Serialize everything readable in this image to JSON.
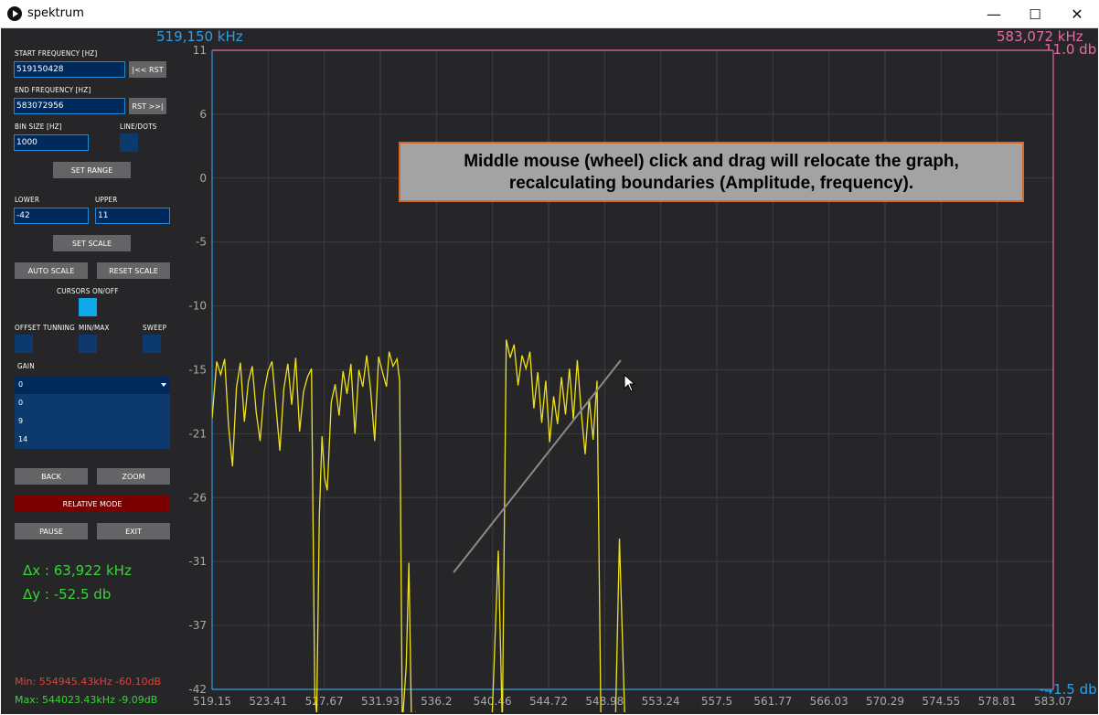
{
  "window": {
    "title": "spektrum",
    "min": "—",
    "max": "☐",
    "close": "✕"
  },
  "sidebar": {
    "start_label": "START FREQUENCY [HZ]",
    "start_value": "519150428",
    "rst_left": "|<< RST",
    "end_label": "END FREQUENCY [HZ]",
    "end_value": "583072956",
    "rst_right": "RST >>|",
    "bin_label": "BIN SIZE [HZ]",
    "bin_value": "1000",
    "line_dots_label": "LINE/DOTS",
    "set_range": "SET RANGE",
    "lower_label": "LOWER",
    "lower_value": "-42",
    "upper_label": "UPPER",
    "upper_value": "11",
    "set_scale": "SET SCALE",
    "auto_scale": "AUTO SCALE",
    "reset_scale": "RESET SCALE",
    "cursors_label": "CURSORS ON/OFF",
    "offset_label": "OFFSET TUNNING",
    "minmax_label": "MIN/MAX",
    "sweep_label": "SWEEP",
    "gain_label": "GAIN",
    "gain_selected": "0",
    "gain_options": [
      "0",
      "9",
      "14"
    ],
    "back": "BACK",
    "zoom": "ZOOM",
    "relative_mode": "RELATIVE MODE",
    "pause": "PAUSE",
    "exit": "EXIT",
    "dx": "Δx : 63,922 kHz",
    "dy": "Δy : -52.5 db",
    "min_stat": "Min: 554945.43kHz -60.10dB",
    "max_stat": "Max: 544023.43kHz -9.09dB"
  },
  "graph": {
    "freq_left": "519,150 kHz",
    "freq_right": "583,072 kHz",
    "amp_top": "11.0 db",
    "amp_bottom": "-41.5 db",
    "tooltip_line1": "Middle mouse (wheel) click and drag will relocate the graph,",
    "tooltip_line2": "recalculating boundaries (Amplitude, frequency).",
    "colors": {
      "trace": "#f0e21a",
      "grid": "#3d3d40",
      "freq_label": "#2e9ee6",
      "upper_label": "#e86aa8",
      "min_color": "#e0403a",
      "max_color": "#3ad43a"
    }
  },
  "chart_data": {
    "type": "line",
    "xlabel": "",
    "ylabel": "",
    "xlim": [
      519.15,
      583.07
    ],
    "ylim": [
      -42,
      11
    ],
    "x_ticks": [
      "519.15",
      "523.41",
      "527.67",
      "531.93",
      "536.2",
      "540.46",
      "544.72",
      "548.98",
      "553.24",
      "557.5",
      "561.77",
      "566.03",
      "570.29",
      "574.55",
      "578.81",
      "583.07"
    ],
    "y_ticks": [
      "11",
      "6",
      "0",
      "-5",
      "-10",
      "-15",
      "-21",
      "-26",
      "-31",
      "-37",
      "-42"
    ],
    "grid": true,
    "series": [
      {
        "color": "#f0e21a",
        "x": [
          519.15,
          519.5,
          519.8,
          520.1,
          520.4,
          520.7,
          521.0,
          521.3,
          521.6,
          521.9,
          522.2,
          522.5,
          522.8,
          523.1,
          523.4,
          523.7,
          524.0,
          524.3,
          524.6,
          524.9,
          525.2,
          525.5,
          525.8,
          526.1,
          526.4,
          526.7,
          526.95,
          527.1,
          527.3,
          527.5,
          527.7,
          527.9,
          528.2,
          528.5,
          528.8,
          529.1,
          529.4,
          529.7,
          530.0,
          530.3,
          530.6,
          530.9,
          531.2,
          531.5,
          531.8,
          532.1,
          532.4,
          532.6,
          532.9,
          533.2,
          533.4,
          533.6,
          533.9,
          534.1,
          534.3,
          534.6,
          534.8,
          535.0,
          535.3,
          535.5,
          535.8,
          536.2,
          536.8,
          537.4,
          538.0,
          538.6,
          539.2,
          539.8,
          540.4,
          540.9,
          541.2,
          541.5,
          541.8,
          542.1,
          542.4,
          542.7,
          543.0,
          543.3,
          543.6,
          543.9,
          544.2,
          544.5,
          544.8,
          545.1,
          545.4,
          545.7,
          546.0,
          546.3,
          546.6,
          546.9,
          547.2,
          547.5,
          547.8,
          548.1,
          548.4,
          548.7,
          548.9,
          549.1,
          549.3,
          549.5,
          549.8,
          550.1,
          550.5,
          551.0,
          551.5,
          552.0
        ],
        "y": [
          -19.5,
          -14.8,
          -15.9,
          -14.6,
          -20.2,
          -23.5,
          -17.0,
          -14.9,
          -19.8,
          -16.5,
          -15.2,
          -19.0,
          -21.4,
          -17.3,
          -15.6,
          -14.8,
          -18.5,
          -22.2,
          -17.1,
          -15.0,
          -18.4,
          -14.5,
          -20.6,
          -17.3,
          -16.1,
          -15.4,
          -42.5,
          -44.0,
          -27.5,
          -21.0,
          -24.5,
          -25.5,
          -18.2,
          -16.7,
          -19.3,
          -15.6,
          -17.5,
          -15.0,
          -20.8,
          -15.5,
          -16.9,
          -14.3,
          -17.2,
          -21.4,
          -14.4,
          -15.7,
          -16.9,
          -14.0,
          -15.2,
          -14.6,
          -16.4,
          -45.0,
          -40.0,
          -31.5,
          -45.0,
          -44.0,
          -45.0,
          -45.0,
          -44.8,
          -44.9,
          -45.0,
          -44.3,
          -44.5,
          -44.6,
          -44.8,
          -45.0,
          -44.7,
          -44.9,
          -45.0,
          -30.5,
          -45.0,
          -13.0,
          -14.5,
          -13.4,
          -16.8,
          -14.3,
          -15.4,
          -14.0,
          -18.7,
          -15.7,
          -19.9,
          -16.4,
          -21.5,
          -17.7,
          -20.0,
          -16.1,
          -19.2,
          -15.4,
          -19.6,
          -14.7,
          -19.0,
          -22.5,
          -17.9,
          -21.3,
          -16.4,
          -45.0,
          -44.7,
          -45.0,
          -44.8,
          -45.0,
          -44.9,
          -29.5,
          -44.0,
          -44.5,
          -44.8,
          -45.0
        ]
      }
    ]
  }
}
